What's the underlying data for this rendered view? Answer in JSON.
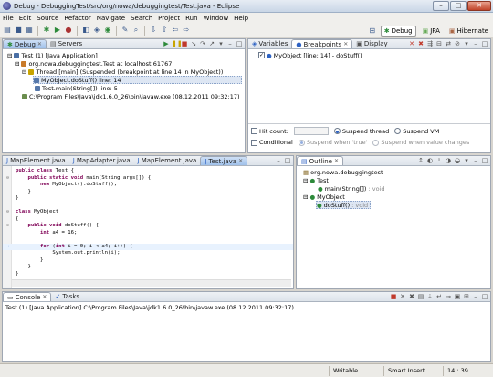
{
  "window": {
    "title": "Debug - DebuggingTest/src/org/nowa/debuggingtest/Test.java - Eclipse",
    "btn_min": "–",
    "btn_max": "□",
    "btn_close": "✕"
  },
  "menu": [
    "File",
    "Edit",
    "Source",
    "Refactor",
    "Navigate",
    "Search",
    "Project",
    "Run",
    "Window",
    "Help"
  ],
  "perspectives": {
    "debug": "Debug",
    "jpa": "JPA",
    "hibernate": "Hibernate"
  },
  "debug_view": {
    "tabs": [
      "Debug",
      "Servers"
    ],
    "tree": [
      "Test (1) [Java Application]",
      "org.nowa.debuggingtest.Test at localhost:61767",
      "Thread [main] (Suspended (breakpoint at line 14 in MyObject))",
      "MyObject.doStuff() line: 14",
      "Test.main(String[]) line: 5",
      "C:\\Program Files\\Java\\jdk1.6.0_26\\bin\\javaw.exe (08.12.2011 09:32:17)"
    ]
  },
  "breakpoints_view": {
    "tabs": [
      "Variables",
      "Breakpoints",
      "Display"
    ],
    "item": "MyObject [line: 14] - doStuff()",
    "hit_count_label": "Hit count:",
    "suspend_thread": "Suspend thread",
    "suspend_vm": "Suspend VM",
    "conditional_label": "Conditional",
    "suspend_true": "Suspend when 'true'",
    "suspend_changes": "Suspend when value changes"
  },
  "editor": {
    "tabs": [
      "MapElement.java",
      "MapAdapter.java",
      "MapElement.java",
      "Test.java"
    ],
    "lines": [
      "public class Test {",
      "    public static void main(String args[]) {",
      "        new MyObject().doStuff();",
      "    }",
      "}",
      "",
      "class MyObject",
      "{",
      "    public void doStuff() {",
      "        int a4 = 16;",
      "",
      "        for (int i = 0; i < a4; i++) {",
      "            System.out.println(i);",
      "        }",
      "    }",
      "}"
    ]
  },
  "outline": {
    "tabs": [
      "Outline"
    ],
    "items": [
      "org.nowa.debuggingtest",
      "Test",
      "main(String[])",
      " : void",
      "MyObject",
      "doStuff()",
      " : void"
    ]
  },
  "console": {
    "tabs": [
      "Console",
      "Tasks"
    ],
    "text": "Test (1) [Java Application] C:\\Program Files\\Java\\jdk1.6.0_26\\bin\\javaw.exe (08.12.2011 09:32:17)"
  },
  "status": {
    "writable": "Writable",
    "insert": "Smart Insert",
    "position": "14 : 39"
  }
}
